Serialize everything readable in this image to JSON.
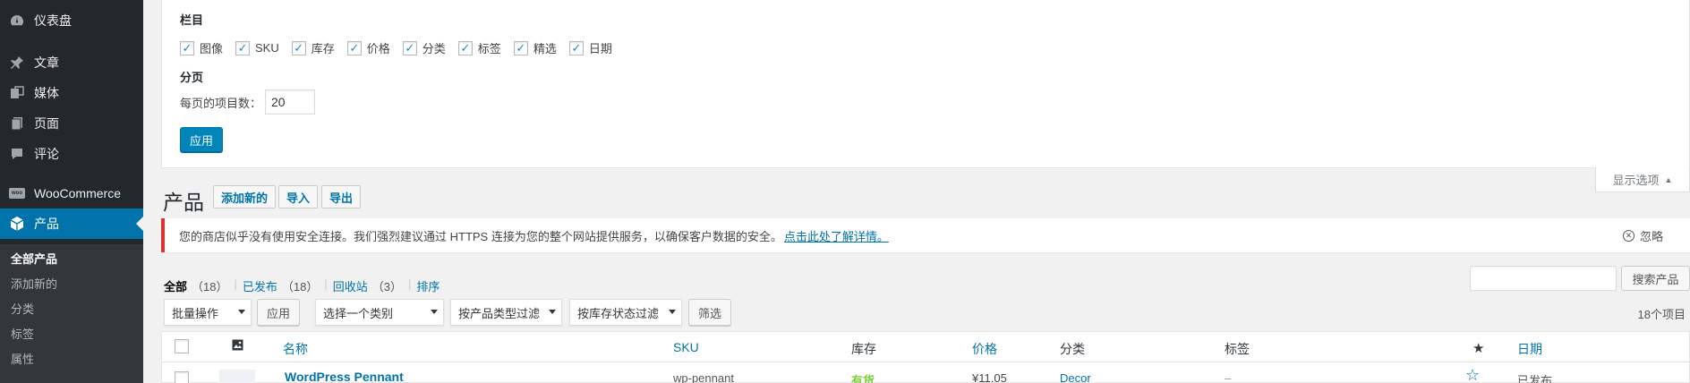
{
  "sidebar": {
    "items": [
      {
        "label": "仪表盘",
        "icon": "dashboard-icon"
      },
      {
        "label": "文章",
        "icon": "pin-icon"
      },
      {
        "label": "媒体",
        "icon": "media-icon"
      },
      {
        "label": "页面",
        "icon": "page-icon"
      },
      {
        "label": "评论",
        "icon": "comment-icon"
      },
      {
        "label": "WooCommerce",
        "icon": "woocommerce-icon"
      },
      {
        "label": "产品",
        "icon": "product-box-icon"
      }
    ],
    "submenu": [
      "全部产品",
      "添加新的",
      "分类",
      "标签",
      "属性"
    ]
  },
  "screen_options": {
    "columns_heading": "栏目",
    "columns": [
      "图像",
      "SKU",
      "库存",
      "价格",
      "分类",
      "标签",
      "精选",
      "日期"
    ],
    "pagination_heading": "分页",
    "per_page_label": "每页的项目数：",
    "per_page_value": "20",
    "apply_label": "应用",
    "tab_label": "显示选项"
  },
  "header": {
    "title": "产品",
    "add_new": "添加新的",
    "import": "导入",
    "export": "导出"
  },
  "notice": {
    "text": "您的商店似乎没有使用安全连接。我们强烈建议通过 HTTPS 连接为您的整个网站提供服务，以确保客户数据的安全。",
    "link": "点击此处了解详情。",
    "dismiss": "忽略"
  },
  "views": {
    "all_label": "全部",
    "all_count": "（18）",
    "published_label": "已发布",
    "published_count": "（18）",
    "trash_label": "回收站",
    "trash_count": "（3）",
    "sorting_label": "排序"
  },
  "search": {
    "button": "搜索产品",
    "value": ""
  },
  "tablenav": {
    "bulk_actions": "批量操作",
    "apply": "应用",
    "category_filter": "选择一个类别",
    "type_filter": "按产品类型过滤",
    "stock_filter": "按库存状态过滤",
    "filter_button": "筛选",
    "count": "18个项目"
  },
  "table": {
    "columns": {
      "name": "名称",
      "sku": "SKU",
      "stock": "库存",
      "price": "价格",
      "categories": "分类",
      "tags": "标签",
      "featured_icon": "star-filled-icon",
      "date": "日期"
    },
    "rows": [
      {
        "name": "WordPress Pennant",
        "sku": "wp-pennant",
        "stock": "有货",
        "price": "¥11.05",
        "categories": "Decor",
        "tags": "–",
        "featured_icon": "star-outline-icon",
        "date": "已发布"
      }
    ]
  },
  "colors": {
    "sidebar_bg": "#23282d",
    "accent": "#0073aa",
    "notice_border": "#dc3232",
    "in_stock": "#7ad03a"
  }
}
